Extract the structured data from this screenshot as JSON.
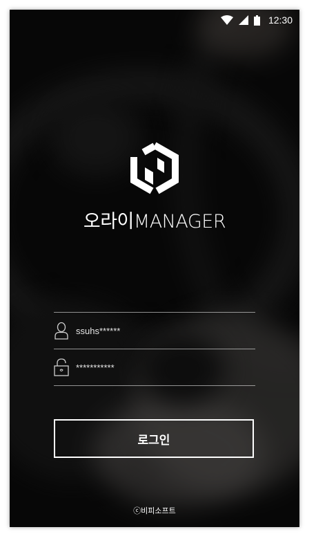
{
  "status_bar": {
    "time": "12:30"
  },
  "app": {
    "title": "오라이MANAGER"
  },
  "login_form": {
    "username_value": "ssuhs******",
    "password_value": "***********",
    "login_button_label": "로그인"
  },
  "footer": {
    "copyright": "ⓒ비피소프트"
  },
  "colors": {
    "accent": "#ffffff",
    "background": "#0c0c0c"
  },
  "icons": [
    "wifi-icon",
    "signal-icon",
    "battery-icon",
    "app-logo-icon",
    "user-icon",
    "lock-icon"
  ]
}
